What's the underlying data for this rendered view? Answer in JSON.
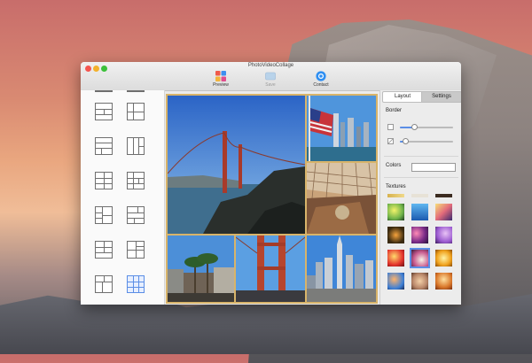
{
  "window": {
    "title": "PhotoVideoCollage"
  },
  "toolbar": {
    "preview_label": "Preview",
    "save_label": "Save",
    "contact_label": "Contact",
    "preview_icon": "preview-icon",
    "save_icon": "save-icon",
    "contact_icon": "contact-icon"
  },
  "layouts": {
    "selected_index": 11,
    "count": 12
  },
  "sidebar": {
    "tabs": [
      {
        "label": "Layout",
        "selected": true
      },
      {
        "label": "Settings",
        "selected": false
      }
    ],
    "border_label": "Border",
    "border_width_level": 0.25,
    "corner_radius_level": 0.05,
    "colors_label": "Colors",
    "textures_label": "Textures",
    "selected_texture_index": 13
  },
  "colors": {
    "accent": "#5b8ee6",
    "canvas_border": "#d8b46a"
  }
}
